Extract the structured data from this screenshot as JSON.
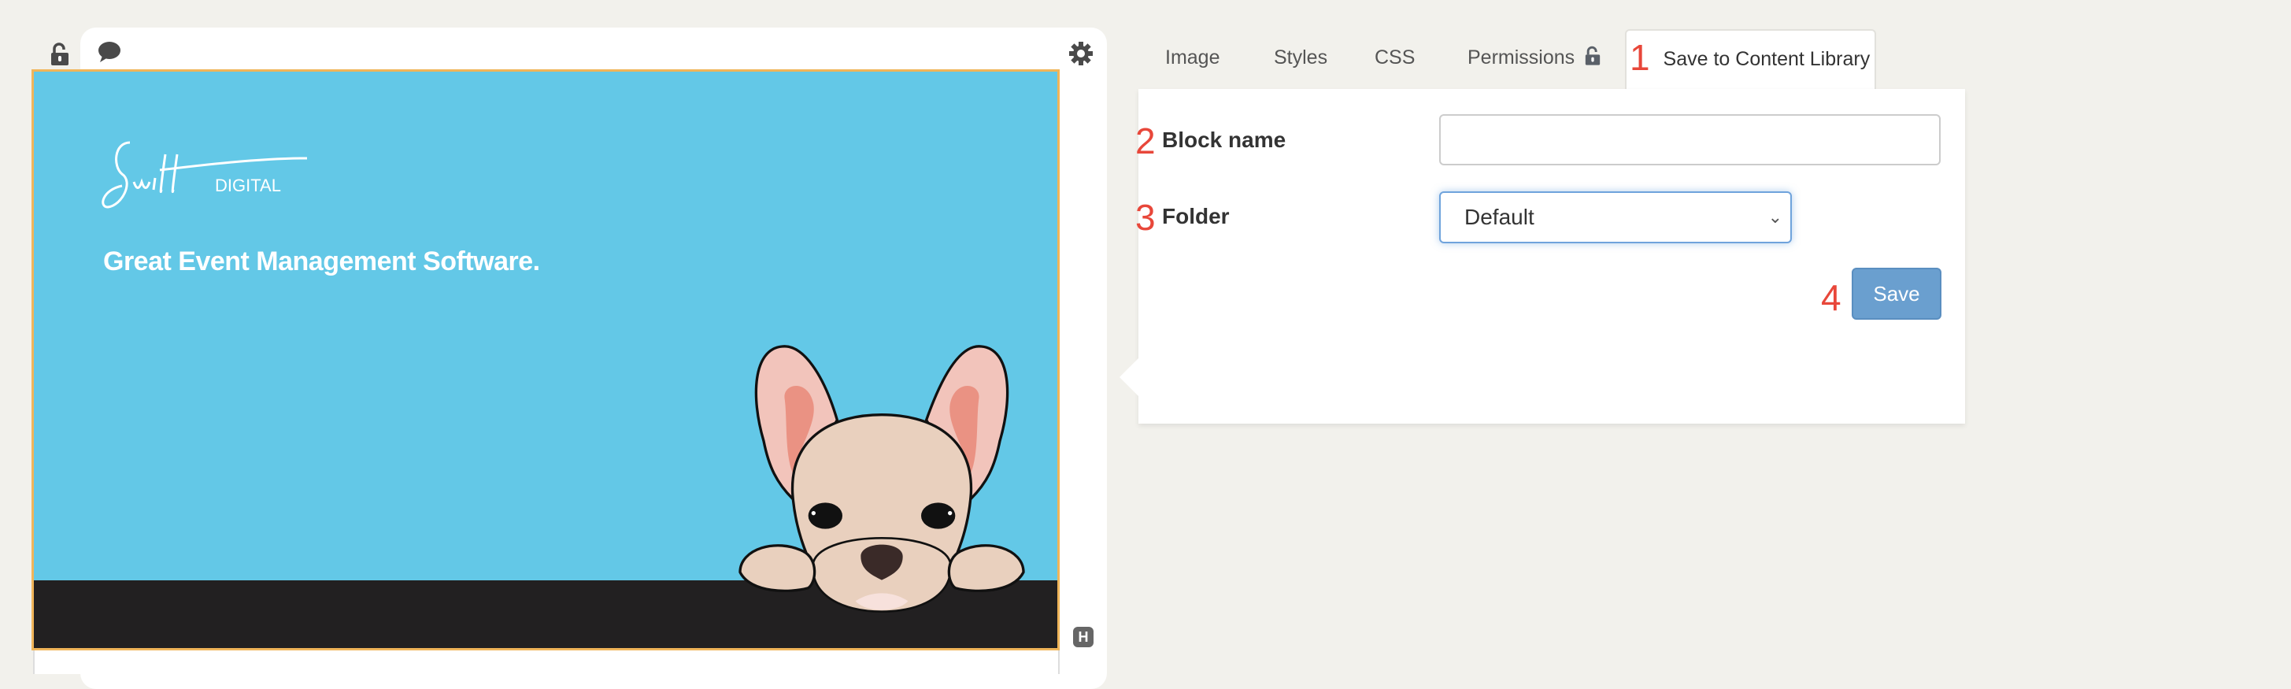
{
  "editor": {
    "icons": {
      "lock": "lock-open-icon",
      "comment": "comment-icon",
      "settings": "gear-icon",
      "heading": "h-badge-icon"
    },
    "heading_badge": "H",
    "hero": {
      "logo_text": "Swift DIGITAL",
      "headline": "Great Event Management Software.",
      "colors": {
        "background": "#63c8e7",
        "ground": "#222021",
        "selection_border": "#f0b55a"
      }
    }
  },
  "panel": {
    "tabs": [
      {
        "label": "Image",
        "active": false
      },
      {
        "label": "Styles",
        "active": false
      },
      {
        "label": "CSS",
        "active": false
      },
      {
        "label": "Permissions",
        "active": false,
        "icon": "lock-open-icon"
      },
      {
        "label": "Save to Content Library",
        "active": true
      }
    ],
    "annotations": [
      "1",
      "2",
      "3",
      "4"
    ],
    "annotation_color": "#e8473a",
    "block_name": {
      "label": "Block name",
      "value": ""
    },
    "folder": {
      "label": "Folder",
      "selected": "Default"
    },
    "save_label": "Save",
    "accent": "#6a9fcf"
  }
}
